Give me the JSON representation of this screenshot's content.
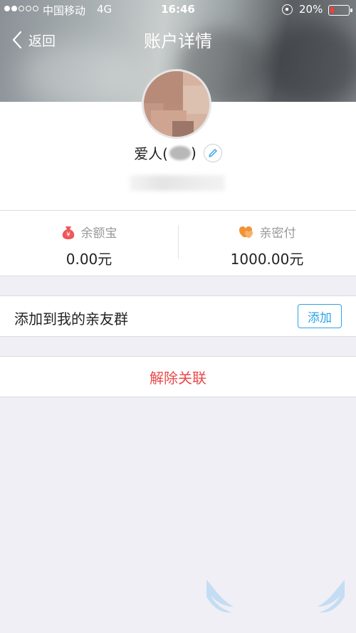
{
  "status_bar": {
    "carrier": "中国移动",
    "network": "4G",
    "time": "16:46",
    "battery": "20%"
  },
  "nav": {
    "back_label": "返回",
    "title": "账户详情"
  },
  "profile": {
    "name": "爱人("
  },
  "balances": [
    {
      "label": "余额宝",
      "value": "0.00元",
      "icon": "moneybag-icon",
      "color": "#f0565a"
    },
    {
      "label": "亲密付",
      "value": "1000.00元",
      "icon": "hearts-icon",
      "color": "#f39233"
    }
  ],
  "family": {
    "label": "添加到我的亲友群",
    "button": "添加"
  },
  "unlink": {
    "label": "解除关联"
  },
  "colors": {
    "accent": "#2ea3e6",
    "danger": "#e94a4a",
    "background": "#f0eff5"
  }
}
